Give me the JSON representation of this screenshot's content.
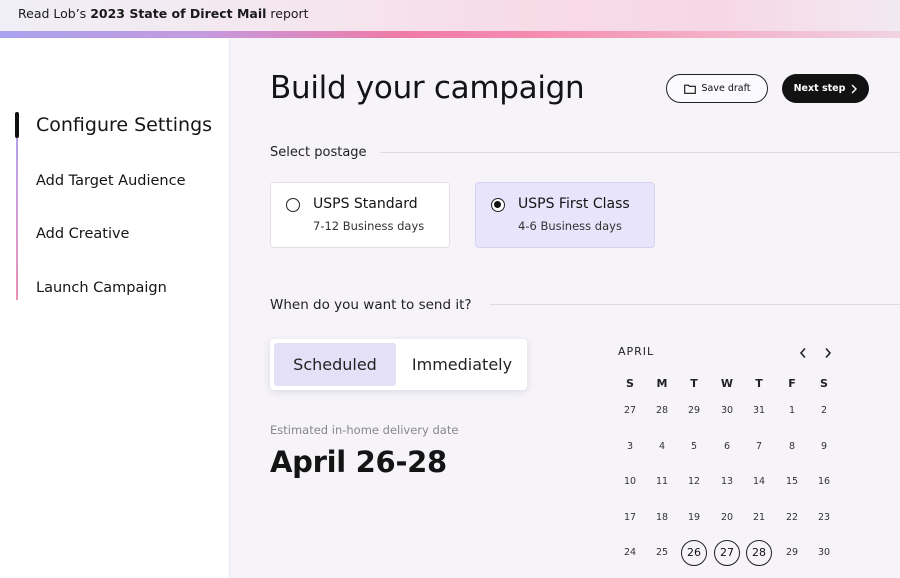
{
  "banner": {
    "prefix": "Read Lob’s",
    "highlight": "2023 State of Direct Mail",
    "suffix": "report"
  },
  "sidebar": {
    "steps": [
      {
        "label": "Configure Settings"
      },
      {
        "label": "Add Target Audience"
      },
      {
        "label": "Add Creative"
      },
      {
        "label": "Launch Campaign"
      }
    ]
  },
  "header": {
    "title": "Build your campaign",
    "save_label": "Save draft",
    "next_label": "Next step",
    "save_icon": "folder-icon",
    "next_icon": "chevron-right-icon"
  },
  "postage": {
    "label": "Select postage",
    "options": [
      {
        "title": "USPS Standard",
        "subtitle": "7-12 Business days",
        "selected": false
      },
      {
        "title": "USPS First Class",
        "subtitle": "4-6 Business days",
        "selected": true
      }
    ]
  },
  "send": {
    "label": "When do you want to send it?",
    "options": [
      "Scheduled",
      "Immediately"
    ],
    "selected": "Scheduled"
  },
  "estimate": {
    "label": "Estimated in-home delivery date",
    "value": "April 26-28"
  },
  "calendar": {
    "month": "APRIL",
    "prev_icon": "chevron-left-icon",
    "next_icon": "chevron-right-icon",
    "weekdays": [
      "S",
      "M",
      "T",
      "W",
      "T",
      "F",
      "S"
    ],
    "weeks": [
      [
        "27",
        "28",
        "29",
        "30",
        "31",
        "1",
        "2"
      ],
      [
        "3",
        "4",
        "5",
        "6",
        "7",
        "8",
        "9"
      ],
      [
        "10",
        "11",
        "12",
        "13",
        "14",
        "15",
        "16"
      ],
      [
        "17",
        "18",
        "19",
        "20",
        "21",
        "22",
        "23"
      ],
      [
        "24",
        "25",
        "26",
        "27",
        "28",
        "29",
        "30"
      ]
    ],
    "highlighted": [
      "26",
      "27",
      "28"
    ]
  },
  "colors": {
    "accent": "#e7e4fb",
    "dark": "#121212"
  }
}
